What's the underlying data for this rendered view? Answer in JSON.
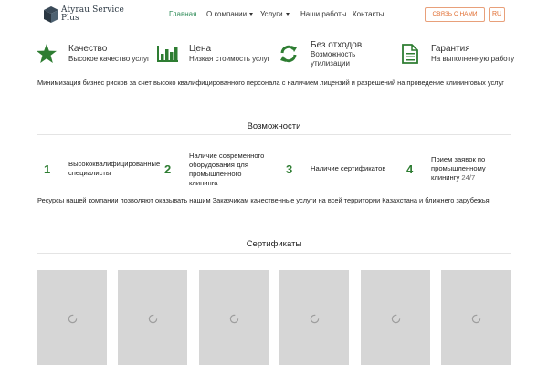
{
  "header": {
    "logo": {
      "line1": "Atyrau Service",
      "line2": "Plus"
    },
    "nav": [
      {
        "label": "Главная",
        "active": true
      },
      {
        "label": "О компании",
        "dropdown": true
      },
      {
        "label": "Услуги",
        "dropdown": true
      },
      {
        "label": "Наши работы"
      },
      {
        "label": "Контакты"
      }
    ],
    "contact_button": "СВЯЗЬ С НАМИ",
    "language": "RU"
  },
  "features": [
    {
      "icon": "star-icon",
      "title": "Качество",
      "subtitle": "Высокое качество услуг"
    },
    {
      "icon": "bar-chart-icon",
      "title": "Цена",
      "subtitle": "Низкая стоимость услуг"
    },
    {
      "icon": "recycle-icon",
      "title": "Без отходов",
      "subtitle": "Возможность утилизации"
    },
    {
      "icon": "document-icon",
      "title": "Гарантия",
      "subtitle": "На выполненную работу"
    }
  ],
  "intro_text": "Минимизация бизнес рисков за счет высоко квалифицированного персонала с наличием лицензий и разрешений на проведение клининговых услуг",
  "advantages": {
    "title": "Возможности",
    "items": [
      {
        "number": "1",
        "text": "Высококвалифицированные специалисты"
      },
      {
        "number": "2",
        "text": "Наличие современного оборудования для промышленного клининга"
      },
      {
        "number": "3",
        "text": "Наличие сертификатов"
      },
      {
        "number": "4",
        "text": "Прием заявок по промышленному клинингу",
        "suffix": "24/7"
      }
    ],
    "footer_text": "Ресурсы нашей компании позволяют оказывать нашим Заказчикам качественные услуги на всей территории Казахстана и ближнего зарубежья"
  },
  "certificates": {
    "title": "Сертификаты",
    "count": 6
  },
  "colors": {
    "accent_green": "#2e7d32",
    "nav_active": "#2e8b57",
    "contact_orange": "#e06a2c",
    "placeholder_gray": "#d6d6d6"
  }
}
